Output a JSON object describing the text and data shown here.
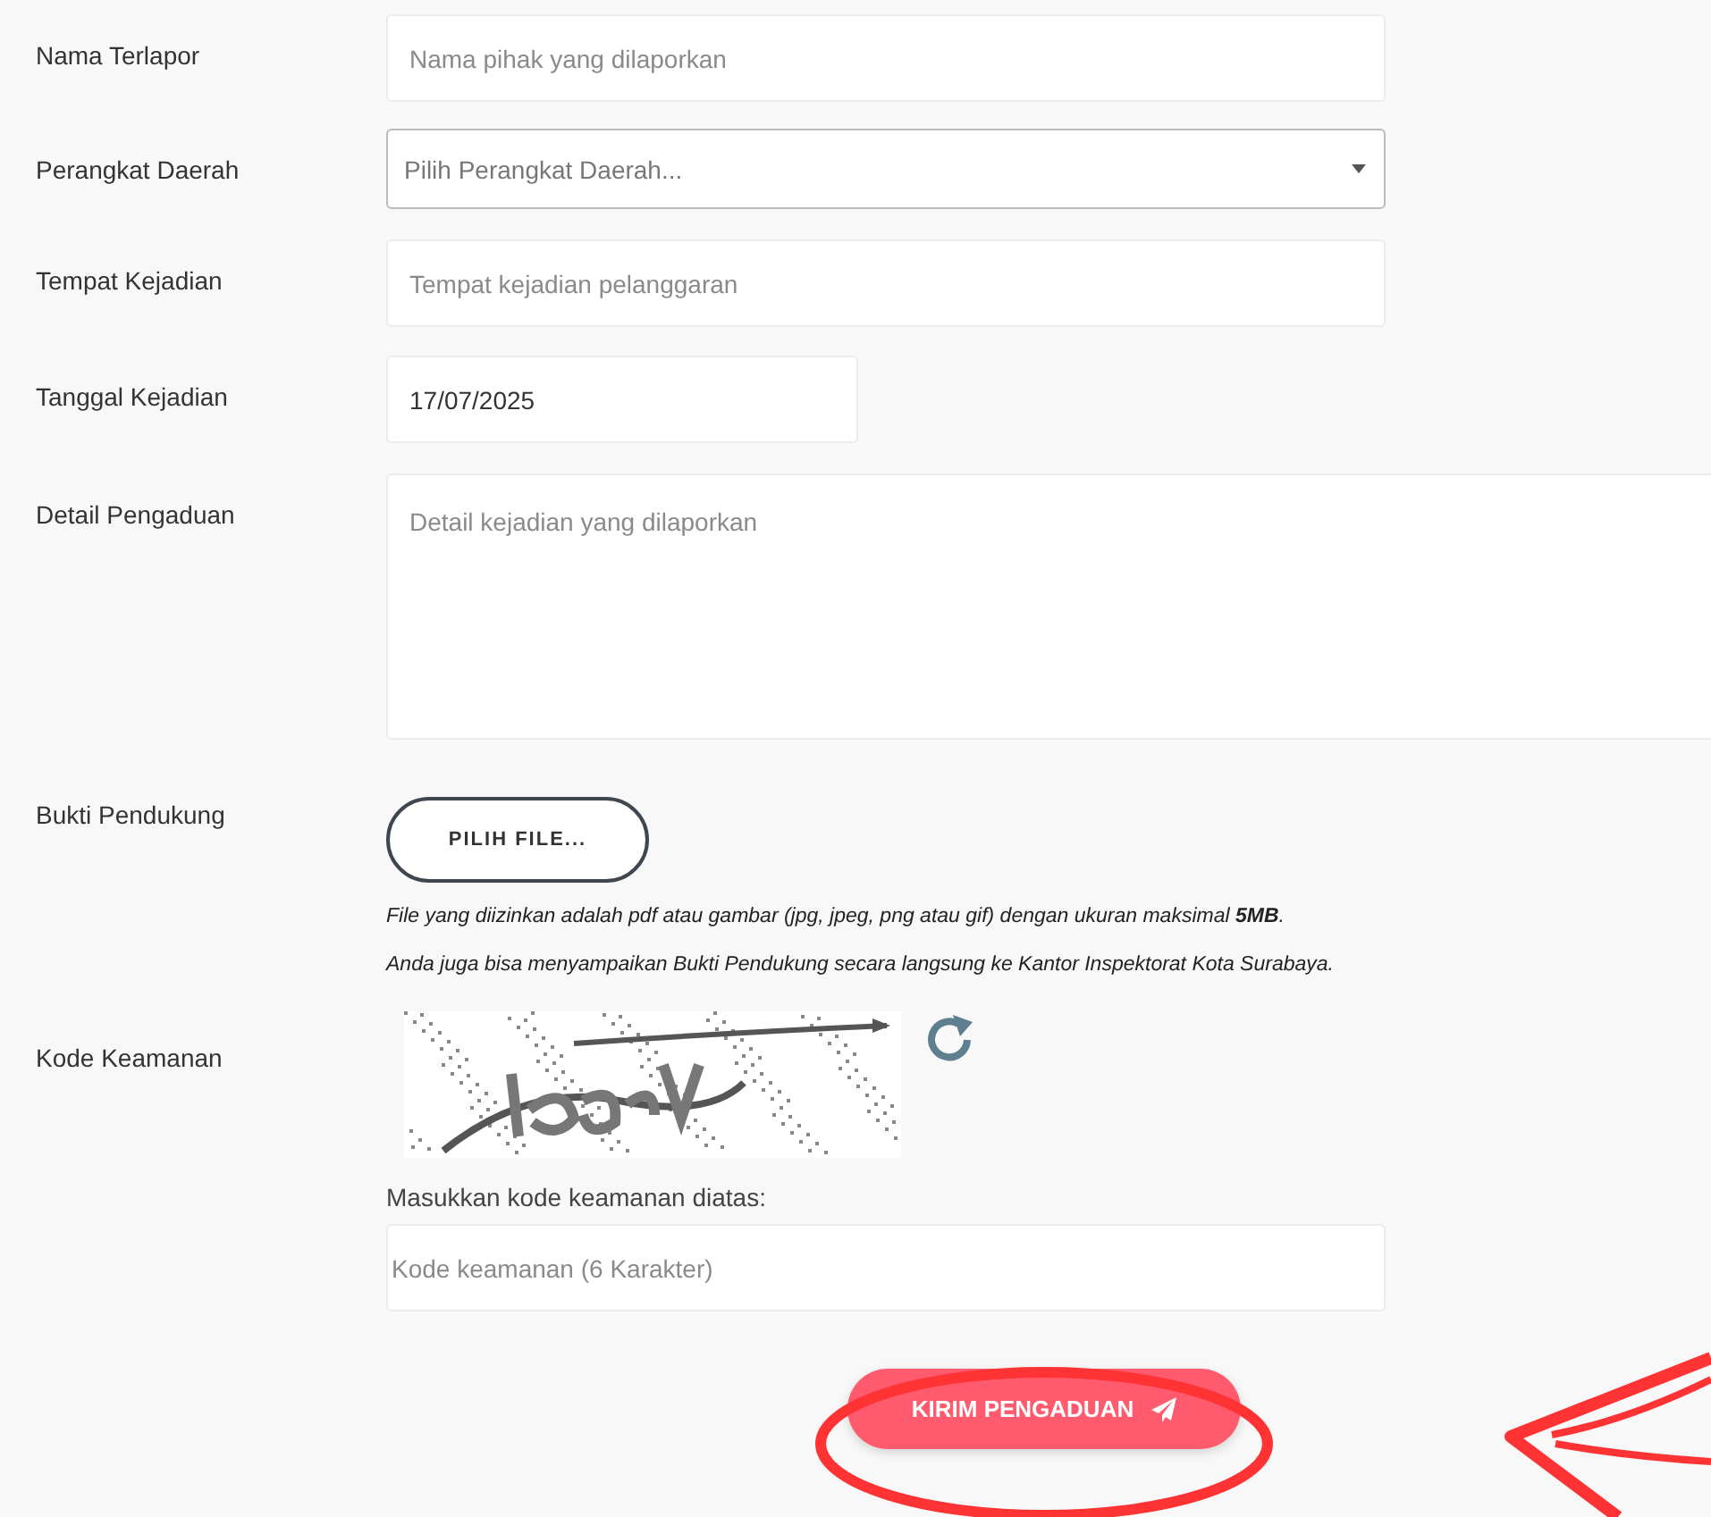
{
  "form": {
    "rows": [
      {
        "kind": "text",
        "label": "Nama Terlapor",
        "placeholder": "Nama pihak yang dilaporkan"
      },
      {
        "kind": "select",
        "label": "Perangkat Daerah",
        "placeholder": "Pilih Perangkat Daerah..."
      },
      {
        "kind": "text",
        "label": "Tempat Kejadian",
        "placeholder": "Tempat kejadian pelanggaran"
      },
      {
        "kind": "date",
        "label": "Tanggal Kejadian",
        "value": "17/07/2025"
      },
      {
        "kind": "textarea",
        "label": "Detail Pengaduan",
        "placeholder": "Detail kejadian yang dilaporkan"
      },
      {
        "kind": "file",
        "label": "Bukti Pendukung",
        "button": "PILIH FILE...",
        "notes": [
          "File yang diizinkan adalah pdf atau gambar (jpg, jpeg, png atau gif) dengan ukuran maksimal **5MB**.",
          "Anda juga bisa menyampaikan Bukti Pendukung secara langsung ke Kantor Inspektorat Kota Surabaya."
        ]
      },
      {
        "kind": "captcha",
        "label": "Kode Keamanan",
        "hint": "Masukkan kode keamanan diatas:",
        "placeholder": "Kode keamanan (6 Karakter)"
      }
    ],
    "submit": "KIRIM PENGADUAN"
  }
}
